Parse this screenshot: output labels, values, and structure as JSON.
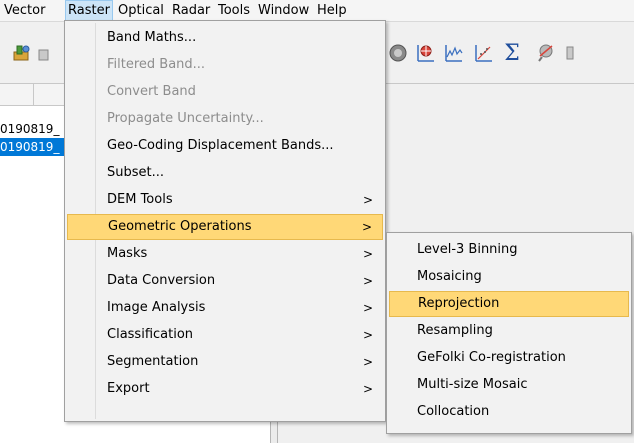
{
  "menubar": {
    "items": [
      {
        "label": "Vector"
      },
      {
        "label": "Raster"
      },
      {
        "label": "Optical"
      },
      {
        "label": "Radar"
      },
      {
        "label": "Tools"
      },
      {
        "label": "Window"
      },
      {
        "label": "Help"
      }
    ],
    "active": "Raster"
  },
  "toolbar": {
    "icons": [
      "tool-icon",
      "tool-icon-partial",
      "globe-icon",
      "wind-rose-icon",
      "spectrum-icon",
      "scatter-plot-icon",
      "sigma-icon",
      "pin-icon",
      "partial-icon"
    ]
  },
  "product_tree": {
    "rows": [
      {
        "label": "0190819_"
      },
      {
        "label": "0190819_"
      }
    ],
    "selected_index": 1
  },
  "raster_menu": {
    "items": [
      {
        "label": "Band Maths...",
        "enabled": true,
        "submenu": false
      },
      {
        "label": "Filtered Band...",
        "enabled": false,
        "submenu": false
      },
      {
        "label": "Convert Band",
        "enabled": false,
        "submenu": false
      },
      {
        "label": "Propagate Uncertainty...",
        "enabled": false,
        "submenu": false
      },
      {
        "label": "Geo-Coding Displacement Bands...",
        "enabled": true,
        "submenu": false
      },
      {
        "label": "Subset...",
        "enabled": true,
        "submenu": false
      },
      {
        "label": "DEM Tools",
        "enabled": true,
        "submenu": true
      },
      {
        "label": "Geometric Operations",
        "enabled": true,
        "submenu": true
      },
      {
        "label": "Masks",
        "enabled": true,
        "submenu": true
      },
      {
        "label": "Data Conversion",
        "enabled": true,
        "submenu": true
      },
      {
        "label": "Image Analysis",
        "enabled": true,
        "submenu": true
      },
      {
        "label": "Classification",
        "enabled": true,
        "submenu": true
      },
      {
        "label": "Segmentation",
        "enabled": true,
        "submenu": true
      },
      {
        "label": "Export",
        "enabled": true,
        "submenu": true
      }
    ],
    "highlighted": "Geometric Operations",
    "arrow_glyph": ">"
  },
  "geometric_submenu": {
    "items": [
      {
        "label": "Level-3 Binning"
      },
      {
        "label": "Mosaicing"
      },
      {
        "label": "Reprojection"
      },
      {
        "label": "Resampling"
      },
      {
        "label": "GeFolki Co-registration"
      },
      {
        "label": "Multi-size Mosaic"
      },
      {
        "label": "Collocation"
      }
    ],
    "highlighted": "Reprojection"
  },
  "colors": {
    "menu_highlight": "#ffd877",
    "menu_highlight_border": "#e7b94d",
    "selection_blue": "#0078d7",
    "menubar_active": "#cce4f7",
    "disabled_text": "#8d8d8d"
  }
}
